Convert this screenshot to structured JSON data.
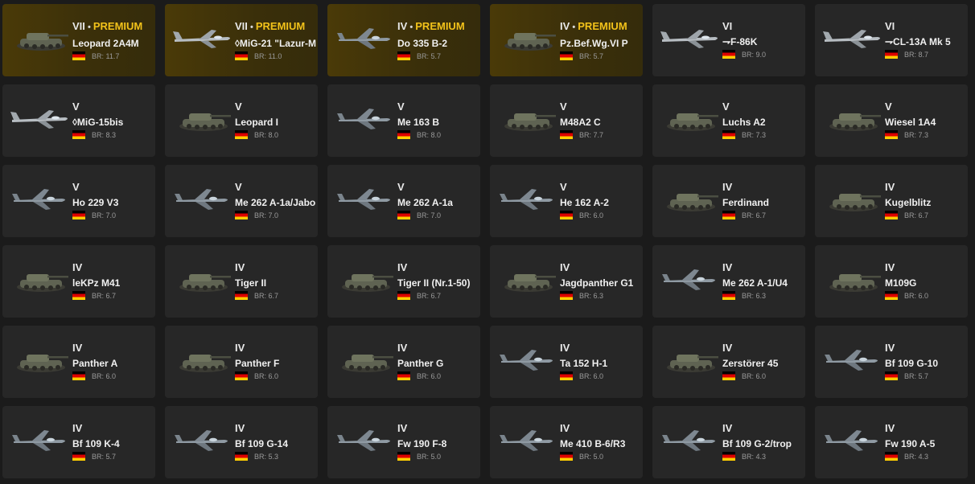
{
  "colors": {
    "background": "#1b1b1b",
    "card": "#272727",
    "premium_gold": "#f2c21a",
    "premium_card": "#3a2f0a"
  },
  "vehicles": [
    {
      "rank": "VII",
      "premium": true,
      "premium_label": "PREMIUM",
      "name": "Leopard 2A4M",
      "br": "BR: 11.7",
      "kind": "tank"
    },
    {
      "rank": "VII",
      "premium": true,
      "premium_label": "PREMIUM",
      "name": "◊MiG-21 \"Lazur-M",
      "br": "BR: 11.0",
      "kind": "jet"
    },
    {
      "rank": "IV",
      "premium": true,
      "premium_label": "PREMIUM",
      "name": "Do 335 B-2",
      "br": "BR: 5.7",
      "kind": "plane"
    },
    {
      "rank": "IV",
      "premium": true,
      "premium_label": "PREMIUM",
      "name": "Pz.Bef.Wg.VI P",
      "br": "BR: 5.7",
      "kind": "tank"
    },
    {
      "rank": "VI",
      "premium": false,
      "name": "⇁F-86K",
      "br": "BR: 9.0",
      "kind": "jet"
    },
    {
      "rank": "VI",
      "premium": false,
      "name": "⇁CL-13A Mk 5",
      "br": "BR: 8.7",
      "kind": "jet"
    },
    {
      "rank": "V",
      "premium": false,
      "name": "◊MiG-15bis",
      "br": "BR: 8.3",
      "kind": "jet"
    },
    {
      "rank": "V",
      "premium": false,
      "name": "Leopard I",
      "br": "BR: 8.0",
      "kind": "tank"
    },
    {
      "rank": "V",
      "premium": false,
      "name": "Me 163 B",
      "br": "BR: 8.0",
      "kind": "plane"
    },
    {
      "rank": "V",
      "premium": false,
      "name": "M48A2 C",
      "br": "BR: 7.7",
      "kind": "tank"
    },
    {
      "rank": "V",
      "premium": false,
      "name": "Luchs A2",
      "br": "BR: 7.3",
      "kind": "tank"
    },
    {
      "rank": "V",
      "premium": false,
      "name": "Wiesel 1A4",
      "br": "BR: 7.3",
      "kind": "tank"
    },
    {
      "rank": "V",
      "premium": false,
      "name": "Ho 229 V3",
      "br": "BR: 7.0",
      "kind": "plane"
    },
    {
      "rank": "V",
      "premium": false,
      "name": "Me 262 A-1a/Jabo",
      "br": "BR: 7.0",
      "kind": "plane"
    },
    {
      "rank": "V",
      "premium": false,
      "name": "Me 262 A-1a",
      "br": "BR: 7.0",
      "kind": "plane"
    },
    {
      "rank": "V",
      "premium": false,
      "name": "He 162 A-2",
      "br": "BR: 6.0",
      "kind": "plane"
    },
    {
      "rank": "IV",
      "premium": false,
      "name": "Ferdinand",
      "br": "BR: 6.7",
      "kind": "tank"
    },
    {
      "rank": "IV",
      "premium": false,
      "name": "Kugelblitz",
      "br": "BR: 6.7",
      "kind": "tank"
    },
    {
      "rank": "IV",
      "premium": false,
      "name": "leKPz M41",
      "br": "BR: 6.7",
      "kind": "tank"
    },
    {
      "rank": "IV",
      "premium": false,
      "name": "Tiger II",
      "br": "BR: 6.7",
      "kind": "tank"
    },
    {
      "rank": "IV",
      "premium": false,
      "name": "Tiger II (Nr.1-50)",
      "br": "BR: 6.7",
      "kind": "tank"
    },
    {
      "rank": "IV",
      "premium": false,
      "name": "Jagdpanther G1",
      "br": "BR: 6.3",
      "kind": "tank"
    },
    {
      "rank": "IV",
      "premium": false,
      "name": "Me 262 A-1/U4",
      "br": "BR: 6.3",
      "kind": "plane"
    },
    {
      "rank": "IV",
      "premium": false,
      "name": "M109G",
      "br": "BR: 6.0",
      "kind": "tank"
    },
    {
      "rank": "IV",
      "premium": false,
      "name": "Panther A",
      "br": "BR: 6.0",
      "kind": "tank"
    },
    {
      "rank": "IV",
      "premium": false,
      "name": "Panther F",
      "br": "BR: 6.0",
      "kind": "tank"
    },
    {
      "rank": "IV",
      "premium": false,
      "name": "Panther G",
      "br": "BR: 6.0",
      "kind": "tank"
    },
    {
      "rank": "IV",
      "premium": false,
      "name": "Ta 152 H-1",
      "br": "BR: 6.0",
      "kind": "plane"
    },
    {
      "rank": "IV",
      "premium": false,
      "name": "Zerstörer 45",
      "br": "BR: 6.0",
      "kind": "tank"
    },
    {
      "rank": "IV",
      "premium": false,
      "name": "Bf 109 G-10",
      "br": "BR: 5.7",
      "kind": "plane"
    },
    {
      "rank": "IV",
      "premium": false,
      "name": "Bf 109 K-4",
      "br": "BR: 5.7",
      "kind": "plane"
    },
    {
      "rank": "IV",
      "premium": false,
      "name": "Bf 109 G-14",
      "br": "BR: 5.3",
      "kind": "plane"
    },
    {
      "rank": "IV",
      "premium": false,
      "name": "Fw 190 F-8",
      "br": "BR: 5.0",
      "kind": "plane"
    },
    {
      "rank": "IV",
      "premium": false,
      "name": "Me 410 B-6/R3",
      "br": "BR: 5.0",
      "kind": "plane"
    },
    {
      "rank": "IV",
      "premium": false,
      "name": "Bf 109 G-2/trop",
      "br": "BR: 4.3",
      "kind": "plane"
    },
    {
      "rank": "IV",
      "premium": false,
      "name": "Fw 190 A-5",
      "br": "BR: 4.3",
      "kind": "plane"
    }
  ]
}
